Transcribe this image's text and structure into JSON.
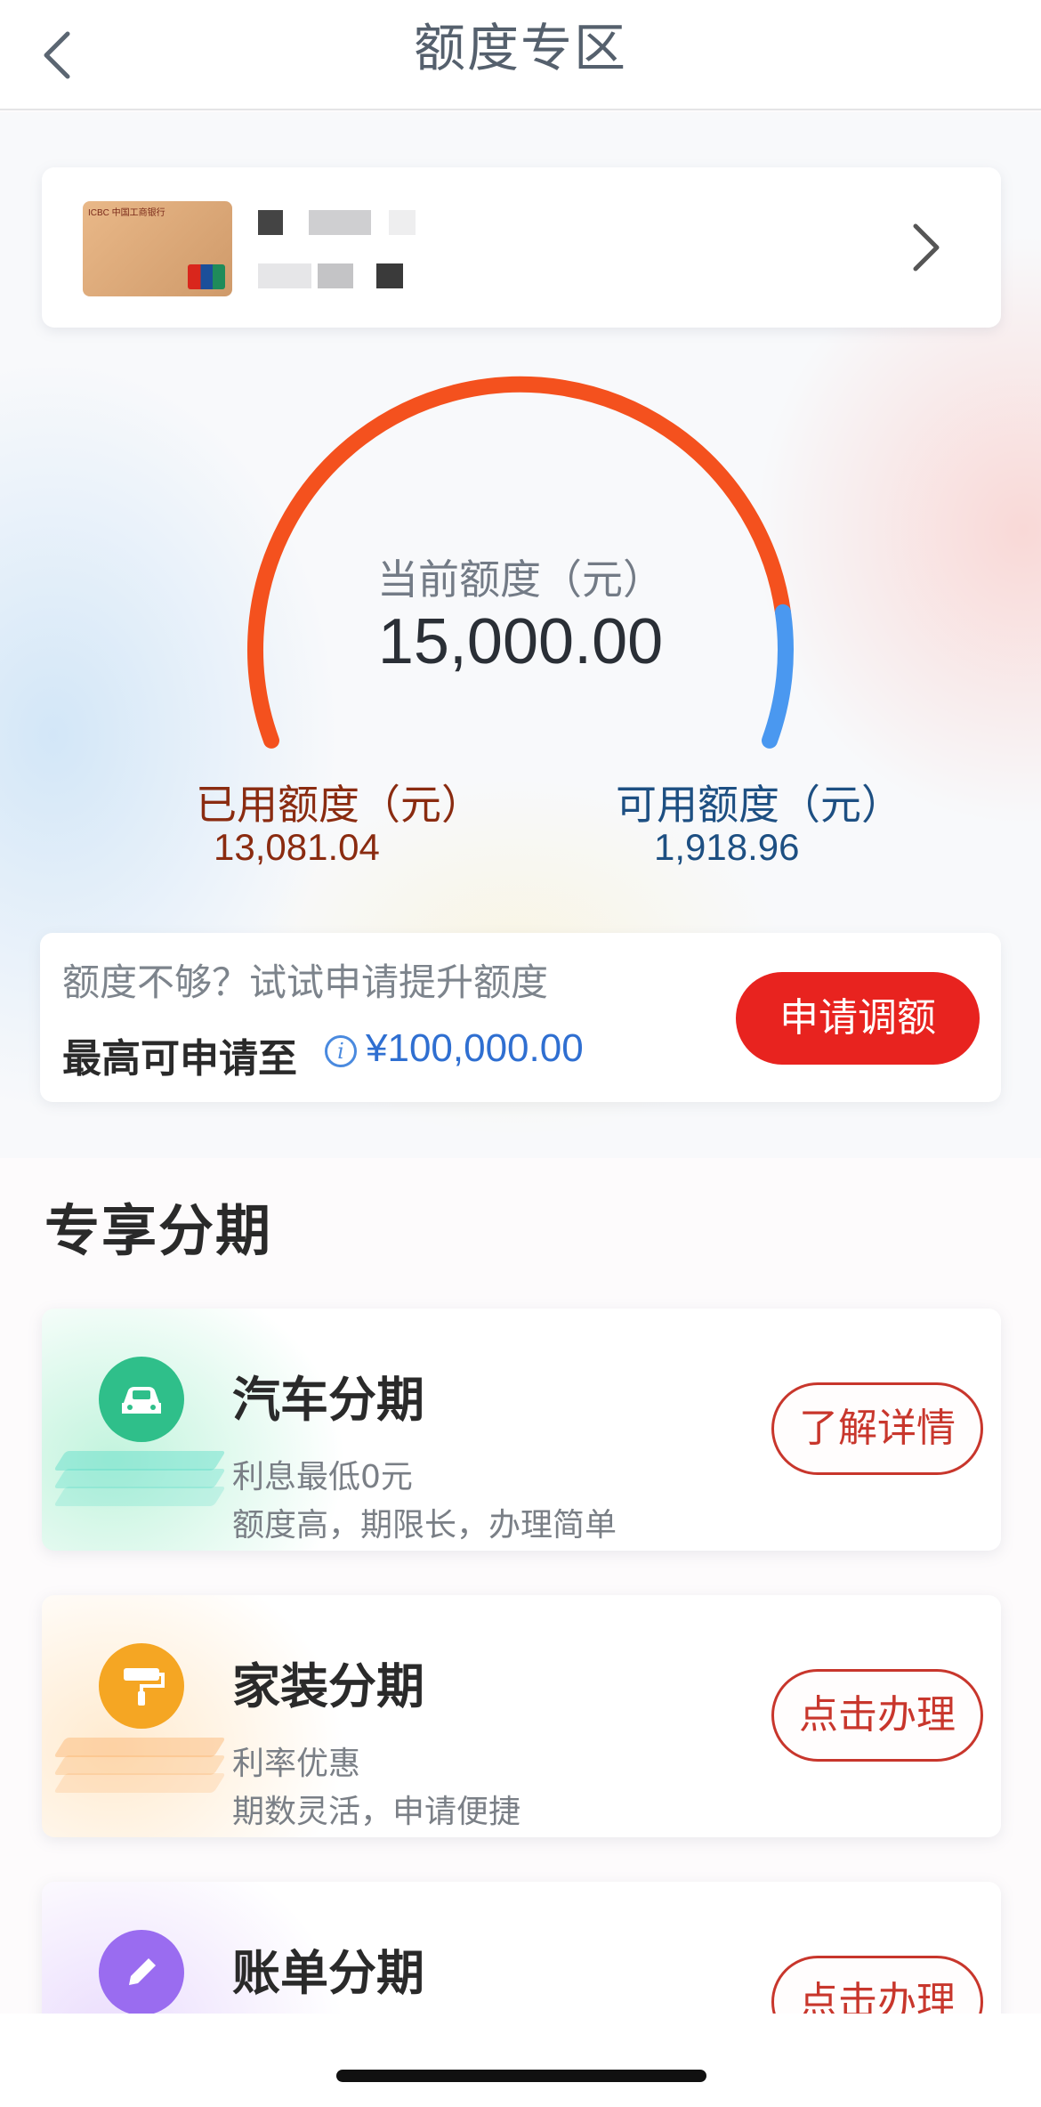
{
  "header": {
    "title": "额度专区"
  },
  "card": {
    "issuer_mark": "ICBC 中国工商银行"
  },
  "limit": {
    "current_label": "当前额度（元）",
    "current_value": "15,000.00",
    "used_label": "已用额度（元）",
    "used_value": "13,081.04",
    "available_label": "可用额度（元）",
    "available_value": "1,918.96",
    "used_fraction": 0.8721,
    "used_color": "#f4511e",
    "available_color": "#4a98f0"
  },
  "raise": {
    "prompt": "额度不够？试试申请提升额度",
    "max_label": "最高可申请至",
    "max_value": "¥100,000.00",
    "button_label": "申请调额"
  },
  "section": {
    "title": "专享分期"
  },
  "installments": [
    {
      "title": "汽车分期",
      "line1": "利息最低0元",
      "line2": "额度高，期限长，办理简单",
      "button": "了解详情",
      "icon": "car-icon",
      "accent": "#2fbf8a"
    },
    {
      "title": "家装分期",
      "line1": "利率优惠",
      "line2": "期数灵活，申请便捷",
      "button": "点击办理",
      "icon": "paint-roller-icon",
      "accent": "#f5a623"
    },
    {
      "title": "账单分期",
      "line1": "",
      "line2": "",
      "button": "点击办理",
      "icon": "pencil-icon",
      "accent": "#9a6cf0"
    }
  ]
}
